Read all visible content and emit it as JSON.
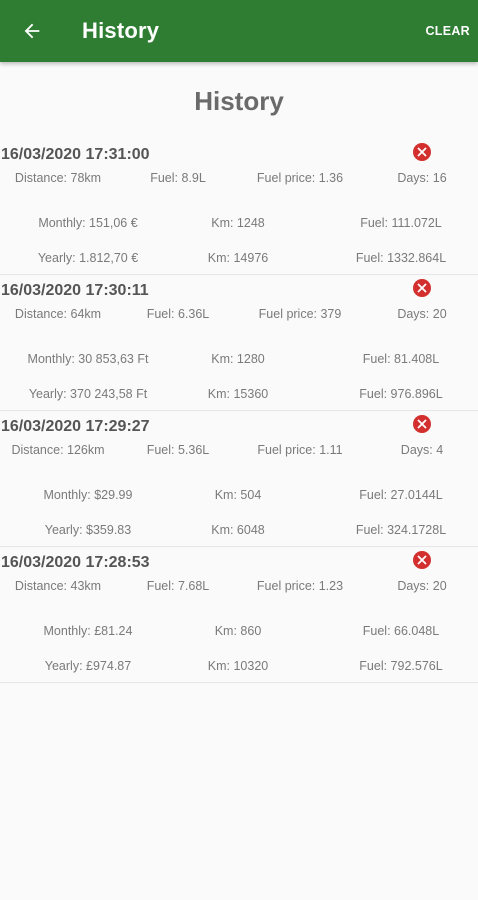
{
  "colors": {
    "accent": "#2e7d32",
    "background": "#fafafa",
    "danger": "#d32f2f"
  },
  "appbar": {
    "back_icon": "arrow-left-icon",
    "title": "History",
    "clear_label": "CLEAR"
  },
  "page": {
    "title": "History"
  },
  "entries": [
    {
      "datetime": "16/03/2020 17:31:00",
      "distance": "Distance: 78km",
      "fuel": "Fuel: 8.9L",
      "fuel_price": "Fuel price: 1.36",
      "days": "Days: 16",
      "monthly": "Monthly: 151,06 €",
      "monthly_km": "Km: 1248",
      "monthly_fuel": "Fuel: 111.072L",
      "yearly": "Yearly: 1.812,70 €",
      "yearly_km": "Km: 14976",
      "yearly_fuel": "Fuel: 1332.864L"
    },
    {
      "datetime": "16/03/2020 17:30:11",
      "distance": "Distance: 64km",
      "fuel": "Fuel: 6.36L",
      "fuel_price": "Fuel price: 379",
      "days": "Days: 20",
      "monthly": "Monthly: 30 853,63 Ft",
      "monthly_km": "Km: 1280",
      "monthly_fuel": "Fuel: 81.408L",
      "yearly": "Yearly: 370 243,58 Ft",
      "yearly_km": "Km: 15360",
      "yearly_fuel": "Fuel: 976.896L"
    },
    {
      "datetime": "16/03/2020 17:29:27",
      "distance": "Distance: 126km",
      "fuel": "Fuel: 5.36L",
      "fuel_price": "Fuel price: 1.11",
      "days": "Days: 4",
      "monthly": "Monthly: $29.99",
      "monthly_km": "Km: 504",
      "monthly_fuel": "Fuel: 27.0144L",
      "yearly": "Yearly: $359.83",
      "yearly_km": "Km: 6048",
      "yearly_fuel": "Fuel: 324.1728L"
    },
    {
      "datetime": "16/03/2020 17:28:53",
      "distance": "Distance: 43km",
      "fuel": "Fuel: 7.68L",
      "fuel_price": "Fuel price: 1.23",
      "days": "Days: 20",
      "monthly": "Monthly: £81.24",
      "monthly_km": "Km: 860",
      "monthly_fuel": "Fuel: 66.048L",
      "yearly": "Yearly: £974.87",
      "yearly_km": "Km: 10320",
      "yearly_fuel": "Fuel: 792.576L"
    }
  ]
}
